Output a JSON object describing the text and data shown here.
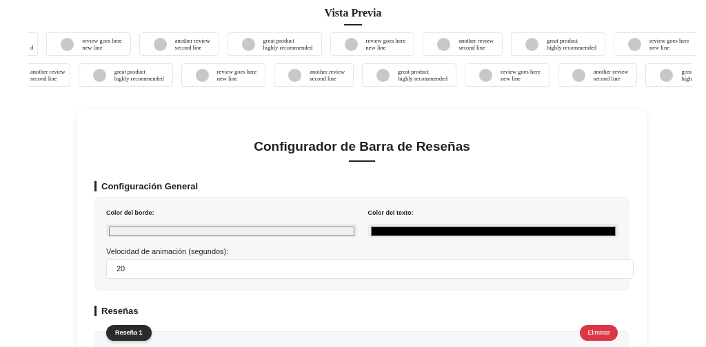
{
  "preview": {
    "title": "Vista Previa",
    "tracks": [
      {
        "items": [
          {
            "kind": "cut_left",
            "line2": "d"
          },
          {
            "kind": "full",
            "line1": "review goes here",
            "line2": "new line"
          },
          {
            "kind": "full",
            "line1": "another review",
            "line2": "second line"
          },
          {
            "kind": "full",
            "line1": "great product",
            "line2": "highly recommended"
          },
          {
            "kind": "full",
            "line1": "review goes here",
            "line2": "new line"
          },
          {
            "kind": "full",
            "line1": "another review",
            "line2": "second line"
          },
          {
            "kind": "full",
            "line1": "great product",
            "line2": "highly recommended"
          },
          {
            "kind": "full",
            "line1": "review goes here",
            "line2": "new line"
          }
        ]
      },
      {
        "items": [
          {
            "kind": "cut_left",
            "line1": "another review",
            "line2": "second line"
          },
          {
            "kind": "full",
            "line1": "great product",
            "line2": "highly recommended"
          },
          {
            "kind": "full",
            "line1": "review goes here",
            "line2": "new line"
          },
          {
            "kind": "full",
            "line1": "another review",
            "line2": "second line"
          },
          {
            "kind": "full",
            "line1": "great product",
            "line2": "highly recommended"
          },
          {
            "kind": "full",
            "line1": "review goes here",
            "line2": "new line"
          },
          {
            "kind": "full",
            "line1": "another review",
            "line2": "second line"
          },
          {
            "kind": "cut_right",
            "line1": "grea",
            "line2": "high"
          }
        ]
      }
    ]
  },
  "configurator": {
    "title": "Configurador de Barra de Reseñas",
    "general": {
      "heading": "Configuración General",
      "border_color": {
        "label": "Color del borde:",
        "color": "#efefef"
      },
      "text_color": {
        "label": "Color del texto:",
        "color": "#000000"
      },
      "speed": {
        "label": "Velocidad de animación (segundos):",
        "value": "20"
      }
    },
    "reviews": {
      "heading": "Reseñas",
      "items": [
        {
          "badge": "Reseña 1",
          "delete": "Eliminar"
        }
      ]
    }
  }
}
